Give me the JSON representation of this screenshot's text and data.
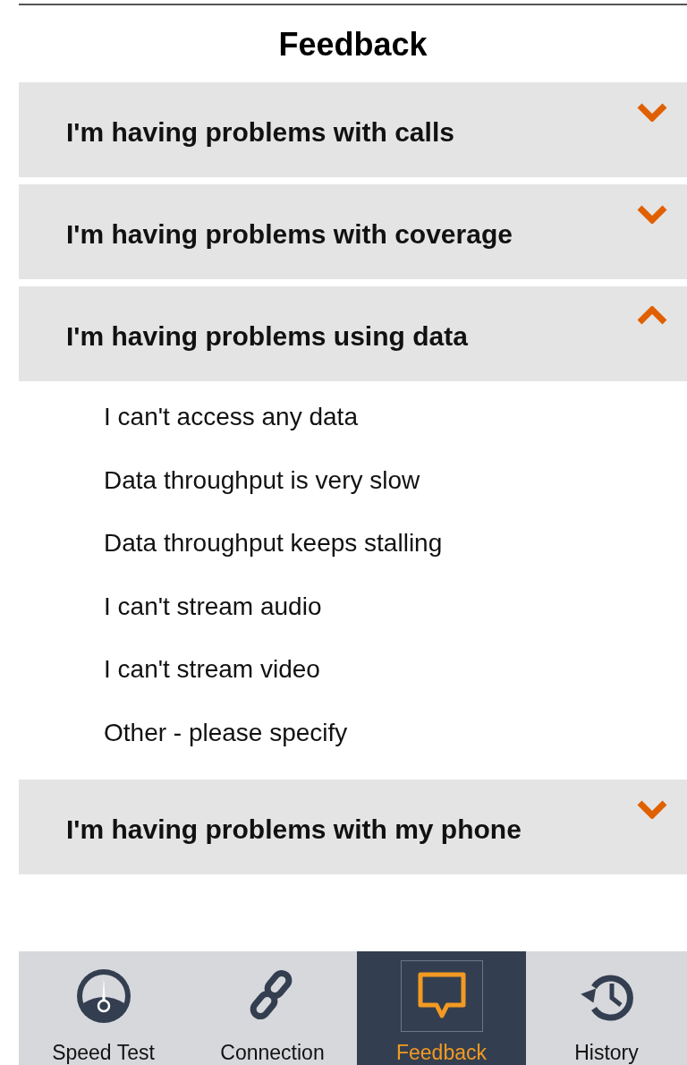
{
  "title": "Feedback",
  "sections": [
    {
      "label": "I'm having problems with calls",
      "expanded": false
    },
    {
      "label": "I'm having problems with coverage",
      "expanded": false
    },
    {
      "label": "I'm having problems using data",
      "expanded": true,
      "options": [
        "I can't access any data",
        "Data throughput is very slow",
        "Data throughput keeps stalling",
        "I can't stream audio",
        "I can't stream video",
        "Other - please specify"
      ]
    },
    {
      "label": "I'm having problems with my phone",
      "expanded": false
    }
  ],
  "nav": [
    {
      "label": "Speed Test",
      "selected": false
    },
    {
      "label": "Connection",
      "selected": false
    },
    {
      "label": "Feedback",
      "selected": true
    },
    {
      "label": "History",
      "selected": false
    }
  ]
}
